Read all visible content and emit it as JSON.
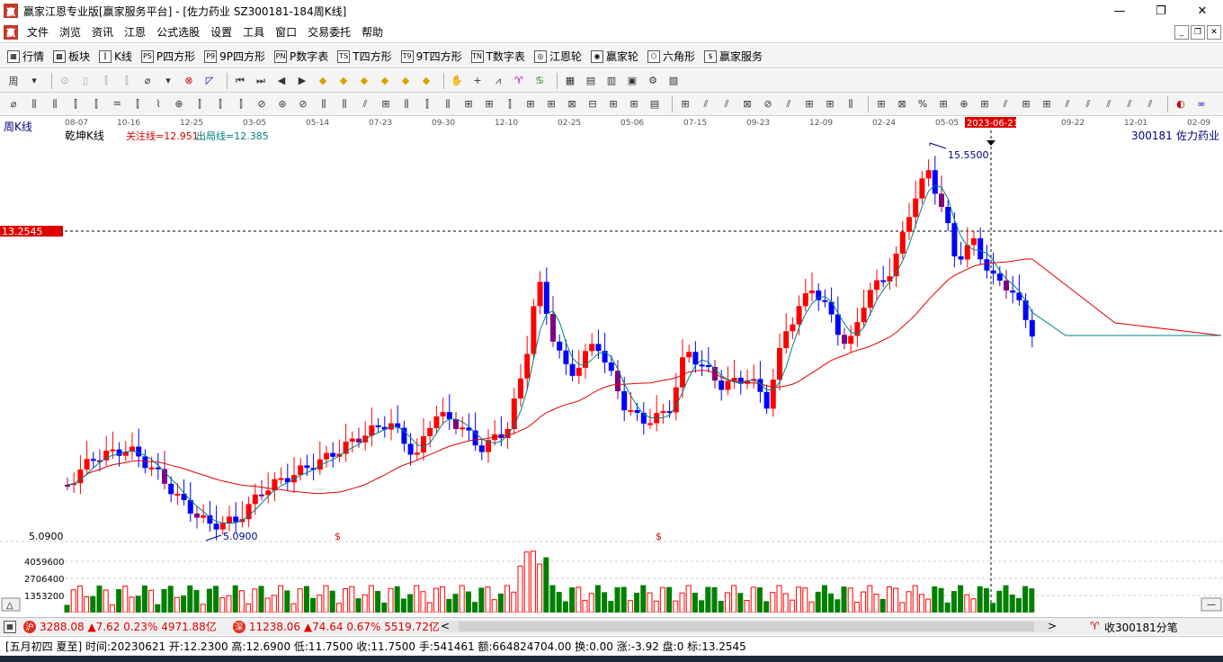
{
  "window": {
    "title": "赢家江恩专业版[赢家服务平台] - [佐力药业   SZ300181-184周K线]",
    "app_icon": "赢",
    "minimize": "—",
    "restore": "❐",
    "close": "✕"
  },
  "menu": {
    "logo": "赢",
    "items": [
      "文件",
      "浏览",
      "资讯",
      "江恩",
      "公式选股",
      "设置",
      "工具",
      "窗口",
      "交易委托",
      "帮助"
    ]
  },
  "toolbar1": {
    "items": [
      {
        "icon": "grid-icon",
        "glyph": "▦",
        "label": "行情"
      },
      {
        "icon": "blocks-icon",
        "glyph": "▩",
        "label": "板块"
      },
      {
        "icon": "kline-icon",
        "glyph": "⫿",
        "label": "K线"
      },
      {
        "icon": "ps-icon",
        "glyph": "PS",
        "label": "P四方形"
      },
      {
        "icon": "p9-icon",
        "glyph": "P9",
        "label": "9P四方形"
      },
      {
        "icon": "pn-icon",
        "glyph": "PN",
        "label": "P数字表"
      },
      {
        "icon": "ts-icon",
        "glyph": "TS",
        "label": "T四方形"
      },
      {
        "icon": "t9-icon",
        "glyph": "T9",
        "label": "9T四方形"
      },
      {
        "icon": "tn-icon",
        "glyph": "TN",
        "label": "T数字表"
      },
      {
        "icon": "gann-wheel-icon",
        "glyph": "◎",
        "label": "江恩轮"
      },
      {
        "icon": "winner-wheel-icon",
        "glyph": "◉",
        "label": "赢家轮"
      },
      {
        "icon": "hexagon-icon",
        "glyph": "⬡",
        "label": "六角形"
      },
      {
        "icon": "dollar-icon",
        "glyph": "$",
        "label": "赢家服务"
      }
    ]
  },
  "chart": {
    "period_label": "周K线",
    "indicator_name": "乾坤K线",
    "focus_line": "关注线=12.951",
    "exit_line": "出局线=12.385",
    "stock_code": "300181",
    "stock_name": "佐力药业",
    "cursor_price": "13.2545",
    "cursor_date": "2023-06-21",
    "high_label": "15.5500",
    "low_label": "5.0900",
    "low_axis_label": "5.0900",
    "dollar_mark": "$",
    "volume_axis": [
      "4059600",
      "2706400",
      "1353200"
    ],
    "date_ticks": [
      "08-07",
      "10-16",
      "12-25",
      "03-05",
      "05-14",
      "07-23",
      "09-30",
      "12-10",
      "02-25",
      "05-06",
      "07-15",
      "09-23",
      "12-09",
      "02-24",
      "05-05",
      "09-22",
      "12-01",
      "02-09"
    ],
    "colors": {
      "up": "#ff0000",
      "down": "#0000ff",
      "neutral": "#800080",
      "ma_fast": "#008080",
      "ma_slow": "#e00000",
      "volume": "#008000"
    }
  },
  "chart_data": {
    "type": "candlestick",
    "title": "",
    "ylim": [
      5.09,
      15.55
    ],
    "cursor": {
      "date": "2023-06-21",
      "open": 12.23,
      "high": 12.69,
      "low": 11.75,
      "close": 11.75
    }
  },
  "status1": {
    "sh_badge": "沪",
    "sh_index": "3288.08",
    "sh_change": "▲7.62",
    "sh_pct": "0.23%",
    "sh_amount": "4971.88亿",
    "sz_badge": "深",
    "sz_index": "11238.06",
    "sz_change": "▲74.64",
    "sz_pct": "0.67%",
    "sz_amount": "5519.72亿",
    "tick_label": "收300181分笔",
    "left_arrow": "<",
    "right_arrow": ">"
  },
  "status2": {
    "text": "[五月初四 夏至] 时间:20230621 开:12.2300 高:12.6900 低:11.7500 收:11.7500 手:541461 额:664824704.00 换:0.00 涨:-3.92 盘:0 标:13.2545"
  }
}
